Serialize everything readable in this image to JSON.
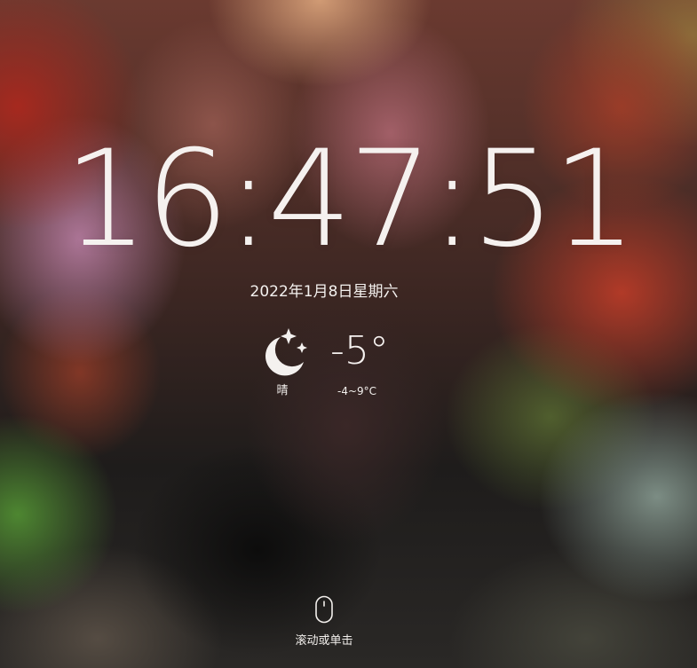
{
  "clock": {
    "time": "16:47:51"
  },
  "date": {
    "text": "2022年1月8日星期六"
  },
  "weather": {
    "icon": "moon-stars-icon",
    "condition": "晴",
    "temperature": "-5°",
    "range": "-4~9°C"
  },
  "footer": {
    "icon": "mouse-icon",
    "hint": "滚动或单击"
  }
}
